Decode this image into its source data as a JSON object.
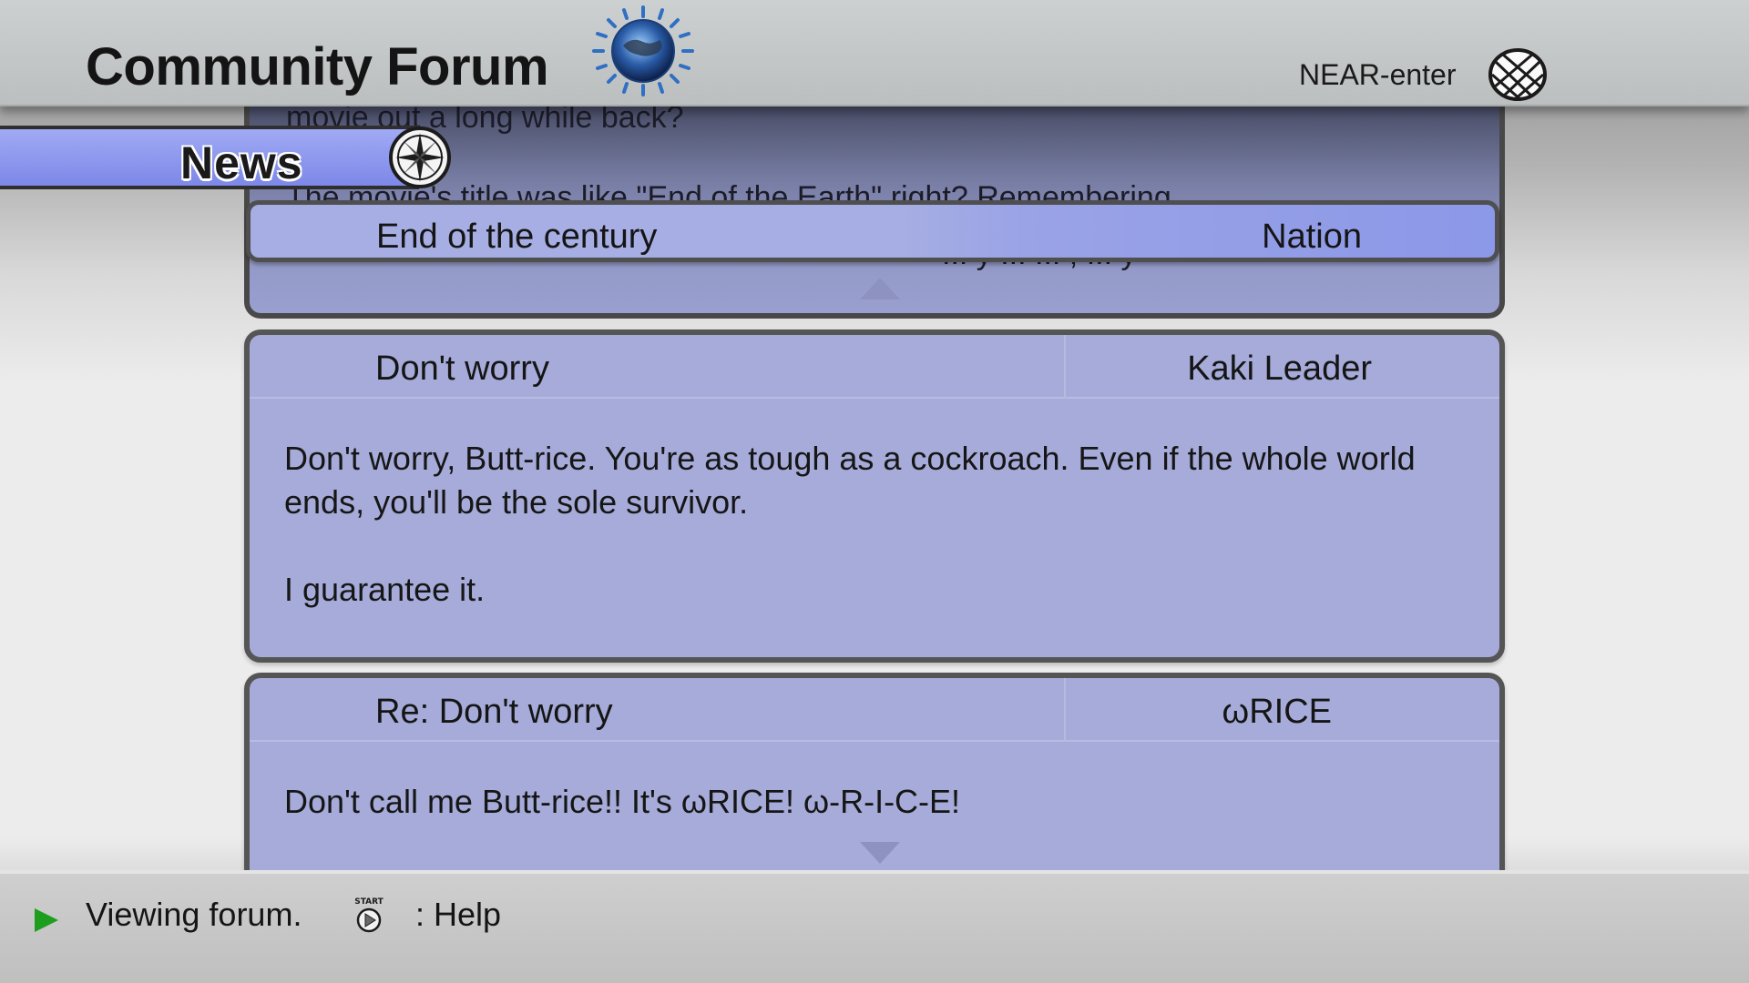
{
  "header": {
    "title": "Community Forum",
    "user": "NEAR-enter",
    "logo_icon": "globe-icon",
    "network_icon": "wireframe-globe-icon"
  },
  "section_tab": {
    "label": "News",
    "icon": "compass-icon"
  },
  "scrolled_post": {
    "line1": "movie out a long while back?",
    "line2": "The movie's title was like \"End of the Earth\" right? Remembering",
    "line3": "... y ... ... , ... y"
  },
  "selected_thread": {
    "title": "End of the century",
    "author": "Nation"
  },
  "posts": [
    {
      "title": "Don't worry",
      "author": "Kaki Leader",
      "body": [
        "Don't worry, Butt-rice. You're as tough as a cockroach. Even if the whole world ends, you'll be the sole survivor.",
        "I guarantee it."
      ]
    },
    {
      "title": "Re: Don't worry",
      "author": "ωRICE",
      "body": [
        "Don't call me Butt-rice!! It's ωRICE! ω-R-I-C-E!"
      ]
    }
  ],
  "footer": {
    "status": "Viewing forum.",
    "help_button_icon": "start-button-icon",
    "help_label": ": Help"
  },
  "colors": {
    "panel": "#a6abd9",
    "tab": "#8e98ee",
    "status_play": "#1e9e1e"
  }
}
